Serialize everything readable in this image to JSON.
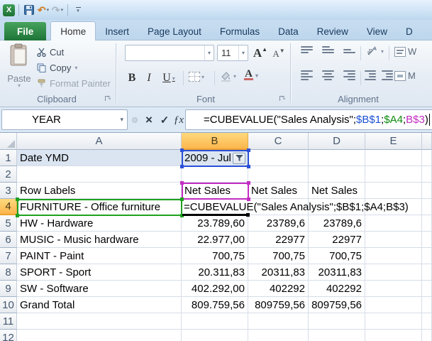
{
  "icons": {
    "undo": "↶",
    "redo": "↷",
    "dropdown": "▾",
    "cancel": "×",
    "enter": "✓",
    "insert_function": "ƒx",
    "bold": "B",
    "italic": "I",
    "underline": "U",
    "grow_font": "A",
    "shrink_font": "A",
    "excel_logo": "X"
  },
  "tabs": {
    "items": [
      {
        "label": "File",
        "file": true
      },
      {
        "label": "Home",
        "active": true
      },
      {
        "label": "Insert"
      },
      {
        "label": "Page Layout"
      },
      {
        "label": "Formulas"
      },
      {
        "label": "Data"
      },
      {
        "label": "Review"
      },
      {
        "label": "View"
      },
      {
        "label": "D"
      }
    ]
  },
  "ribbon": {
    "clipboard": {
      "group_label": "Clipboard",
      "paste_label": "Paste",
      "cut_label": "Cut",
      "copy_label": "Copy",
      "format_painter_label": "Format Painter"
    },
    "font": {
      "group_label": "Font",
      "font_name_value": "",
      "font_size_value": "11"
    },
    "alignment": {
      "group_label": "Alignment",
      "wrap_text_partial": "W",
      "merge_center_partial": "M"
    }
  },
  "formula_bar": {
    "name_box_value": "YEAR",
    "formula_segments": [
      {
        "text": "=CUBEVALUE(\"Sales Analysis\";",
        "color": "#000000"
      },
      {
        "text": "$B$1",
        "color": "#1a4fd6"
      },
      {
        "text": ";",
        "color": "#000000"
      },
      {
        "text": "$A4",
        "color": "#0d8c0d"
      },
      {
        "text": ";",
        "color": "#000000"
      },
      {
        "text": "B$3",
        "color": "#c22cc2"
      },
      {
        "text": ")",
        "color": "#000000"
      }
    ]
  },
  "sheet": {
    "column_headers": [
      "A",
      "B",
      "C",
      "D",
      "E",
      ""
    ],
    "active_column": "B",
    "active_row": "4",
    "pivot_fill_color": "#dbe5f1",
    "references": [
      {
        "cell": "B1",
        "color": "#2b50d8"
      },
      {
        "cell": "B3",
        "color": "#c32cc3"
      },
      {
        "cell": "A4",
        "color": "#1fa11f"
      }
    ],
    "edit_underline_cell": "B4",
    "rows": [
      {
        "n": "1",
        "cells": [
          {
            "col": "A",
            "text": "Date YMD",
            "fill": true
          },
          {
            "col": "B",
            "text": "2009 - Jul",
            "fill": true,
            "filter": true
          }
        ]
      },
      {
        "n": "2",
        "cells": []
      },
      {
        "n": "3",
        "cells": [
          {
            "col": "A",
            "text": "Row Labels"
          },
          {
            "col": "B",
            "text": "Net Sales"
          },
          {
            "col": "C",
            "text": "Net Sales"
          },
          {
            "col": "D",
            "text": "Net Sales"
          }
        ]
      },
      {
        "n": "4",
        "cells": [
          {
            "col": "A",
            "text": "FURNITURE - Office furniture"
          }
        ],
        "formula_overflow": "=CUBEVALUE(\"Sales Analysis\";$B$1;$A4;B$3)"
      },
      {
        "n": "5",
        "cells": [
          {
            "col": "A",
            "text": "HW - Hardware"
          },
          {
            "col": "B",
            "text": "23.789,60",
            "num": true
          },
          {
            "col": "C",
            "text": "23789,6",
            "num": true
          },
          {
            "col": "D",
            "text": "23789,6",
            "num": true
          }
        ]
      },
      {
        "n": "6",
        "cells": [
          {
            "col": "A",
            "text": "MUSIC - Music hardware"
          },
          {
            "col": "B",
            "text": "22.977,00",
            "num": true
          },
          {
            "col": "C",
            "text": "22977",
            "num": true
          },
          {
            "col": "D",
            "text": "22977",
            "num": true
          }
        ]
      },
      {
        "n": "7",
        "cells": [
          {
            "col": "A",
            "text": "PAINT - Paint"
          },
          {
            "col": "B",
            "text": "700,75",
            "num": true
          },
          {
            "col": "C",
            "text": "700,75",
            "num": true
          },
          {
            "col": "D",
            "text": "700,75",
            "num": true
          }
        ]
      },
      {
        "n": "8",
        "cells": [
          {
            "col": "A",
            "text": "SPORT - Sport"
          },
          {
            "col": "B",
            "text": "20.311,83",
            "num": true
          },
          {
            "col": "C",
            "text": "20311,83",
            "num": true
          },
          {
            "col": "D",
            "text": "20311,83",
            "num": true
          }
        ]
      },
      {
        "n": "9",
        "cells": [
          {
            "col": "A",
            "text": "SW - Software"
          },
          {
            "col": "B",
            "text": "402.292,00",
            "num": true
          },
          {
            "col": "C",
            "text": "402292",
            "num": true
          },
          {
            "col": "D",
            "text": "402292",
            "num": true
          }
        ]
      },
      {
        "n": "10",
        "cells": [
          {
            "col": "A",
            "text": "Grand Total"
          },
          {
            "col": "B",
            "text": "809.759,56",
            "num": true
          },
          {
            "col": "C",
            "text": "809759,56",
            "num": true
          },
          {
            "col": "D",
            "text": "809759,56",
            "num": true
          }
        ]
      },
      {
        "n": "11",
        "cells": []
      },
      {
        "n": "12",
        "cells": []
      }
    ]
  }
}
